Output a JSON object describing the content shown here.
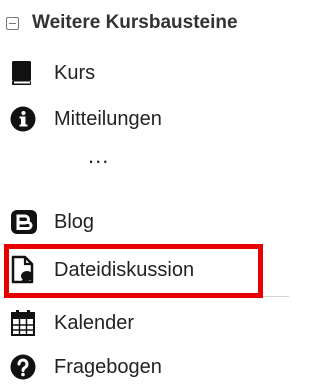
{
  "section": {
    "title": "Weitere Kursbausteine",
    "collapse_icon": "collapse-minus-icon"
  },
  "items": [
    {
      "label": "Kurs",
      "icon": "book-icon"
    },
    {
      "label": "Mitteilungen",
      "icon": "info-icon"
    },
    {
      "label": "Blog",
      "icon": "blog-icon"
    },
    {
      "label": "Dateidiskussion",
      "icon": "file-comment-icon"
    },
    {
      "label": "Kalender",
      "icon": "calendar-icon"
    },
    {
      "label": "Fragebogen",
      "icon": "question-icon"
    }
  ],
  "ellipsis": "...",
  "colors": {
    "highlight": "#e60000",
    "icon": "#111111"
  }
}
